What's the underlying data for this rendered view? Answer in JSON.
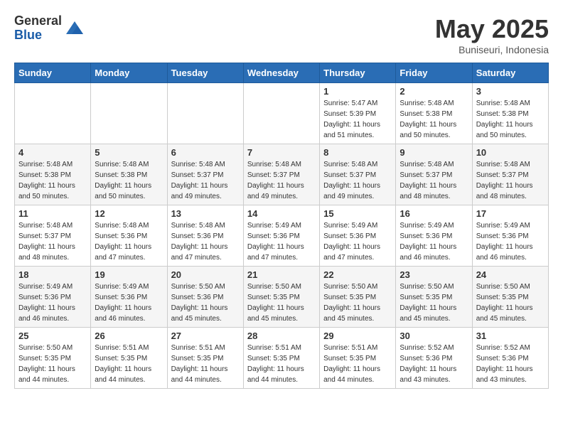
{
  "header": {
    "logo_general": "General",
    "logo_blue": "Blue",
    "month": "May 2025",
    "location": "Buniseuri, Indonesia"
  },
  "weekdays": [
    "Sunday",
    "Monday",
    "Tuesday",
    "Wednesday",
    "Thursday",
    "Friday",
    "Saturday"
  ],
  "weeks": [
    [
      {
        "day": "",
        "info": ""
      },
      {
        "day": "",
        "info": ""
      },
      {
        "day": "",
        "info": ""
      },
      {
        "day": "",
        "info": ""
      },
      {
        "day": "1",
        "info": "Sunrise: 5:47 AM\nSunset: 5:39 PM\nDaylight: 11 hours\nand 51 minutes."
      },
      {
        "day": "2",
        "info": "Sunrise: 5:48 AM\nSunset: 5:38 PM\nDaylight: 11 hours\nand 50 minutes."
      },
      {
        "day": "3",
        "info": "Sunrise: 5:48 AM\nSunset: 5:38 PM\nDaylight: 11 hours\nand 50 minutes."
      }
    ],
    [
      {
        "day": "4",
        "info": "Sunrise: 5:48 AM\nSunset: 5:38 PM\nDaylight: 11 hours\nand 50 minutes."
      },
      {
        "day": "5",
        "info": "Sunrise: 5:48 AM\nSunset: 5:38 PM\nDaylight: 11 hours\nand 50 minutes."
      },
      {
        "day": "6",
        "info": "Sunrise: 5:48 AM\nSunset: 5:37 PM\nDaylight: 11 hours\nand 49 minutes."
      },
      {
        "day": "7",
        "info": "Sunrise: 5:48 AM\nSunset: 5:37 PM\nDaylight: 11 hours\nand 49 minutes."
      },
      {
        "day": "8",
        "info": "Sunrise: 5:48 AM\nSunset: 5:37 PM\nDaylight: 11 hours\nand 49 minutes."
      },
      {
        "day": "9",
        "info": "Sunrise: 5:48 AM\nSunset: 5:37 PM\nDaylight: 11 hours\nand 48 minutes."
      },
      {
        "day": "10",
        "info": "Sunrise: 5:48 AM\nSunset: 5:37 PM\nDaylight: 11 hours\nand 48 minutes."
      }
    ],
    [
      {
        "day": "11",
        "info": "Sunrise: 5:48 AM\nSunset: 5:37 PM\nDaylight: 11 hours\nand 48 minutes."
      },
      {
        "day": "12",
        "info": "Sunrise: 5:48 AM\nSunset: 5:36 PM\nDaylight: 11 hours\nand 47 minutes."
      },
      {
        "day": "13",
        "info": "Sunrise: 5:48 AM\nSunset: 5:36 PM\nDaylight: 11 hours\nand 47 minutes."
      },
      {
        "day": "14",
        "info": "Sunrise: 5:49 AM\nSunset: 5:36 PM\nDaylight: 11 hours\nand 47 minutes."
      },
      {
        "day": "15",
        "info": "Sunrise: 5:49 AM\nSunset: 5:36 PM\nDaylight: 11 hours\nand 47 minutes."
      },
      {
        "day": "16",
        "info": "Sunrise: 5:49 AM\nSunset: 5:36 PM\nDaylight: 11 hours\nand 46 minutes."
      },
      {
        "day": "17",
        "info": "Sunrise: 5:49 AM\nSunset: 5:36 PM\nDaylight: 11 hours\nand 46 minutes."
      }
    ],
    [
      {
        "day": "18",
        "info": "Sunrise: 5:49 AM\nSunset: 5:36 PM\nDaylight: 11 hours\nand 46 minutes."
      },
      {
        "day": "19",
        "info": "Sunrise: 5:49 AM\nSunset: 5:36 PM\nDaylight: 11 hours\nand 46 minutes."
      },
      {
        "day": "20",
        "info": "Sunrise: 5:50 AM\nSunset: 5:36 PM\nDaylight: 11 hours\nand 45 minutes."
      },
      {
        "day": "21",
        "info": "Sunrise: 5:50 AM\nSunset: 5:35 PM\nDaylight: 11 hours\nand 45 minutes."
      },
      {
        "day": "22",
        "info": "Sunrise: 5:50 AM\nSunset: 5:35 PM\nDaylight: 11 hours\nand 45 minutes."
      },
      {
        "day": "23",
        "info": "Sunrise: 5:50 AM\nSunset: 5:35 PM\nDaylight: 11 hours\nand 45 minutes."
      },
      {
        "day": "24",
        "info": "Sunrise: 5:50 AM\nSunset: 5:35 PM\nDaylight: 11 hours\nand 45 minutes."
      }
    ],
    [
      {
        "day": "25",
        "info": "Sunrise: 5:50 AM\nSunset: 5:35 PM\nDaylight: 11 hours\nand 44 minutes."
      },
      {
        "day": "26",
        "info": "Sunrise: 5:51 AM\nSunset: 5:35 PM\nDaylight: 11 hours\nand 44 minutes."
      },
      {
        "day": "27",
        "info": "Sunrise: 5:51 AM\nSunset: 5:35 PM\nDaylight: 11 hours\nand 44 minutes."
      },
      {
        "day": "28",
        "info": "Sunrise: 5:51 AM\nSunset: 5:35 PM\nDaylight: 11 hours\nand 44 minutes."
      },
      {
        "day": "29",
        "info": "Sunrise: 5:51 AM\nSunset: 5:35 PM\nDaylight: 11 hours\nand 44 minutes."
      },
      {
        "day": "30",
        "info": "Sunrise: 5:52 AM\nSunset: 5:36 PM\nDaylight: 11 hours\nand 43 minutes."
      },
      {
        "day": "31",
        "info": "Sunrise: 5:52 AM\nSunset: 5:36 PM\nDaylight: 11 hours\nand 43 minutes."
      }
    ]
  ]
}
